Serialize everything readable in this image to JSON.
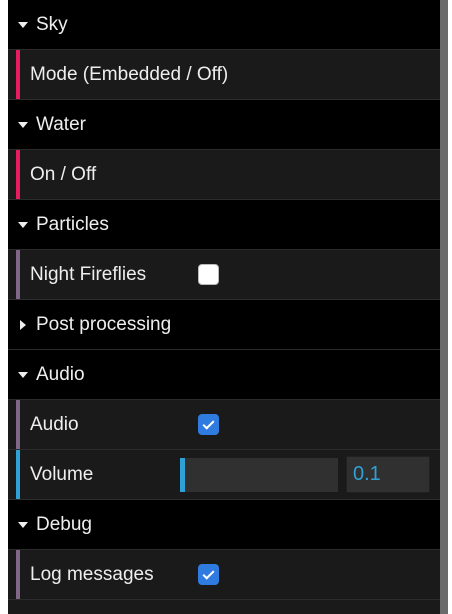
{
  "colors": {
    "function_accent": "#e61d5f",
    "boolean_accent": "#806787",
    "number_accent": "#2fa1d6",
    "checkbox_checked": "#2f7bdf"
  },
  "folders": [
    {
      "title": "Sky",
      "open": true,
      "icon": "chevron-down-icon"
    },
    {
      "title": "Water",
      "open": true,
      "icon": "chevron-down-icon"
    },
    {
      "title": "Particles",
      "open": true,
      "icon": "chevron-down-icon"
    },
    {
      "title": "Post processing",
      "open": false,
      "icon": "chevron-right-icon"
    },
    {
      "title": "Audio",
      "open": true,
      "icon": "chevron-down-icon"
    },
    {
      "title": "Debug",
      "open": true,
      "icon": "chevron-down-icon"
    }
  ],
  "controllers": {
    "sky_mode": {
      "label": "Mode (Embedded / Off)"
    },
    "water_toggle": {
      "label": "On / Off"
    },
    "night_fireflies": {
      "label": "Night Fireflies",
      "checked": false
    },
    "audio": {
      "label": "Audio",
      "checked": true
    },
    "volume": {
      "label": "Volume",
      "value": "0.1",
      "fraction": 0.03
    },
    "log_messages": {
      "label": "Log messages",
      "checked": true
    }
  }
}
